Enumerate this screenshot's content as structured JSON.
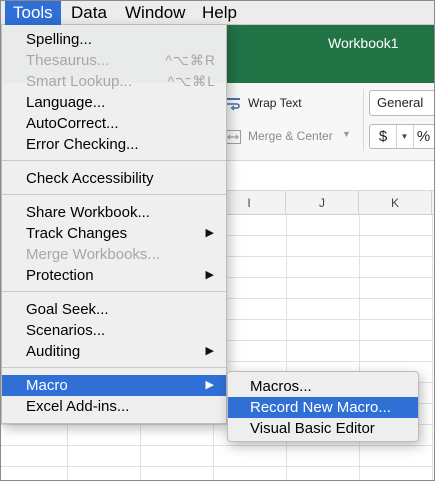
{
  "menubar": {
    "items": [
      {
        "label": "Tools",
        "active": true
      },
      {
        "label": "Data"
      },
      {
        "label": "Window"
      },
      {
        "label": "Help"
      }
    ]
  },
  "app": {
    "workbook_title": "Workbook1",
    "ribbon": {
      "wrap_text": "Wrap Text",
      "merge_center": "Merge & Center",
      "number_format": "General",
      "currency_button": "$",
      "percent_button": "%"
    },
    "columns": [
      "I",
      "J",
      "K"
    ]
  },
  "tools_menu": {
    "items": [
      {
        "label": "Spelling..."
      },
      {
        "label": "Thesaurus...",
        "shortcut": "^⌥⌘R",
        "disabled": true
      },
      {
        "label": "Smart Lookup...",
        "shortcut": "^⌥⌘L",
        "disabled": true
      },
      {
        "label": "Language..."
      },
      {
        "label": "AutoCorrect..."
      },
      {
        "label": "Error Checking..."
      },
      {
        "label": "Check Accessibility"
      },
      {
        "label": "Share Workbook..."
      },
      {
        "label": "Track Changes",
        "submenu": true
      },
      {
        "label": "Merge Workbooks...",
        "disabled": true
      },
      {
        "label": "Protection",
        "submenu": true
      },
      {
        "label": "Goal Seek..."
      },
      {
        "label": "Scenarios..."
      },
      {
        "label": "Auditing",
        "submenu": true
      },
      {
        "label": "Macro",
        "submenu": true,
        "highlighted": true
      },
      {
        "label": "Excel Add-ins..."
      }
    ]
  },
  "macro_submenu": {
    "items": [
      {
        "label": "Macros..."
      },
      {
        "label": "Record New Macro...",
        "highlighted": true
      },
      {
        "label": "Visual Basic Editor"
      }
    ]
  },
  "colors": {
    "menu_highlight": "#2f6fd6",
    "excel_green": "#217346",
    "disabled_text": "#a7a7a7"
  }
}
